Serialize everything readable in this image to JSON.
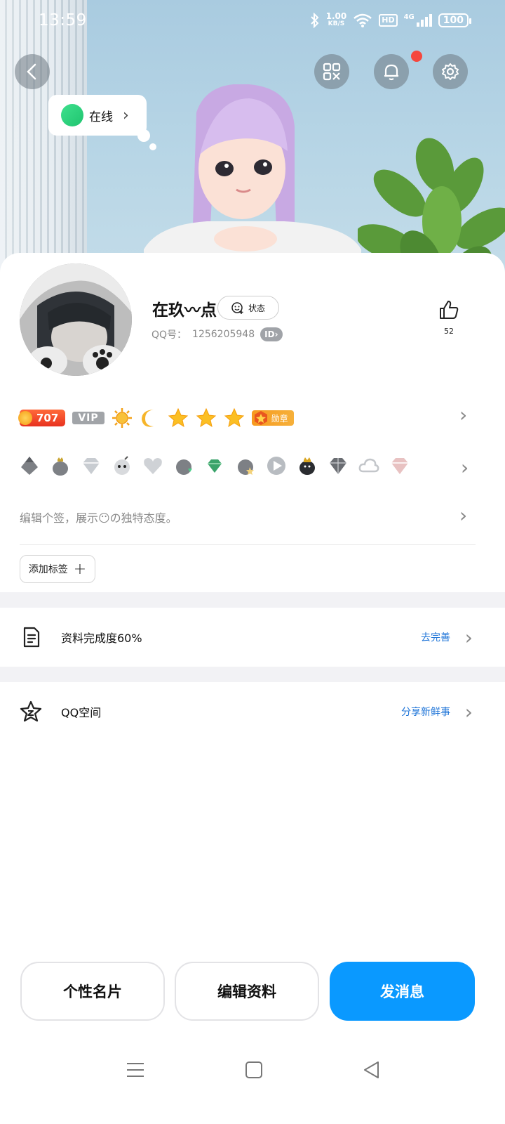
{
  "status_bar": {
    "time": "13:59",
    "net_speed": "1.00",
    "net_unit": "KB/S",
    "hd": "HD",
    "network": "4G",
    "battery": "100"
  },
  "presence": {
    "label": "在线"
  },
  "profile": {
    "name": "在玖〰点",
    "status_button": "状态",
    "qq_label": "QQ号：",
    "qq_number": "1256205948",
    "id_badge": "ID",
    "likes": "52"
  },
  "badges": {
    "level": "707",
    "vip": "VIP",
    "medal": "勋章"
  },
  "signature": {
    "placeholder": "编辑个签，展示😶の独特态度。"
  },
  "tags": {
    "add_label": "添加标签"
  },
  "completion": {
    "label": "资料完成度60%",
    "action": "去完善"
  },
  "qzone": {
    "label": "QQ空间",
    "action": "分享新鲜事"
  },
  "buttons": {
    "card": "个性名片",
    "edit": "编辑资料",
    "message": "发消息"
  },
  "colors": {
    "primary": "#0a99ff",
    "link": "#1e74d8",
    "online": "#2bd47c",
    "notification": "#f5473d"
  }
}
